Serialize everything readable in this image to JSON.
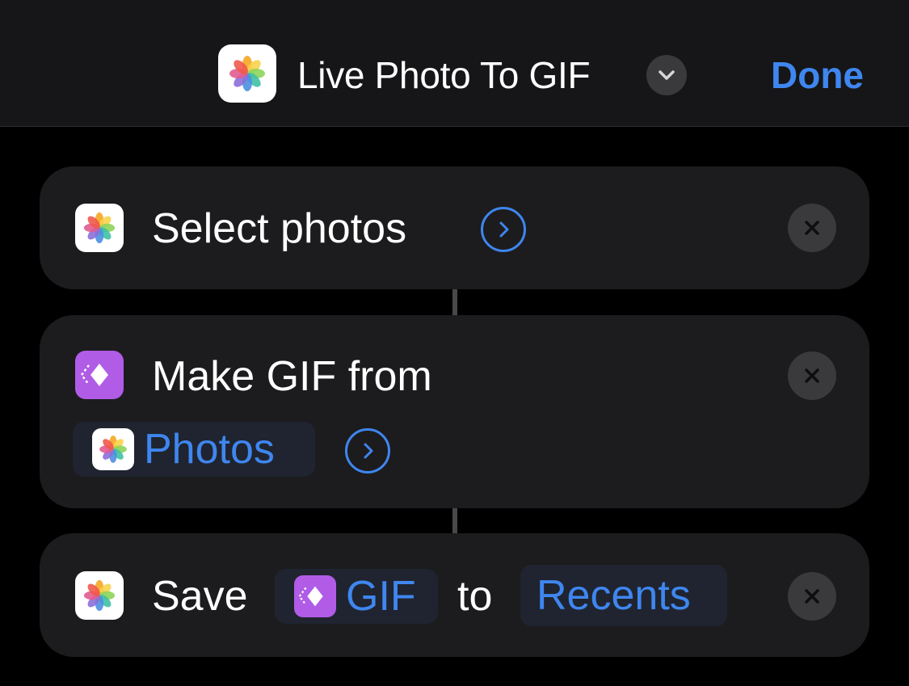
{
  "header": {
    "shortcut_title": "Live Photo To GIF",
    "app_icon": "photos-icon",
    "chevron_icon": "chevron-down-icon",
    "done_label": "Done"
  },
  "actions": [
    {
      "icon": "photos-icon",
      "label": "Select photos",
      "expand_icon": "chevron-right-circle-icon",
      "remove_icon": "close-icon"
    },
    {
      "icon": "make-gif-icon",
      "label": "Make GIF from",
      "input_token": {
        "icon": "photos-icon",
        "label": "Photos"
      },
      "expand_icon": "chevron-right-circle-icon",
      "remove_icon": "close-icon"
    },
    {
      "icon": "photos-icon",
      "label_prefix": "Save",
      "input_token": {
        "icon": "make-gif-icon",
        "label": "GIF"
      },
      "label_middle": "to",
      "album_token": {
        "label": "Recents"
      },
      "remove_icon": "close-icon"
    }
  ],
  "colors": {
    "accent": "#3f86ef",
    "card": "#1c1c1e",
    "background": "#000000",
    "gif_icon": "#b05ce6"
  }
}
